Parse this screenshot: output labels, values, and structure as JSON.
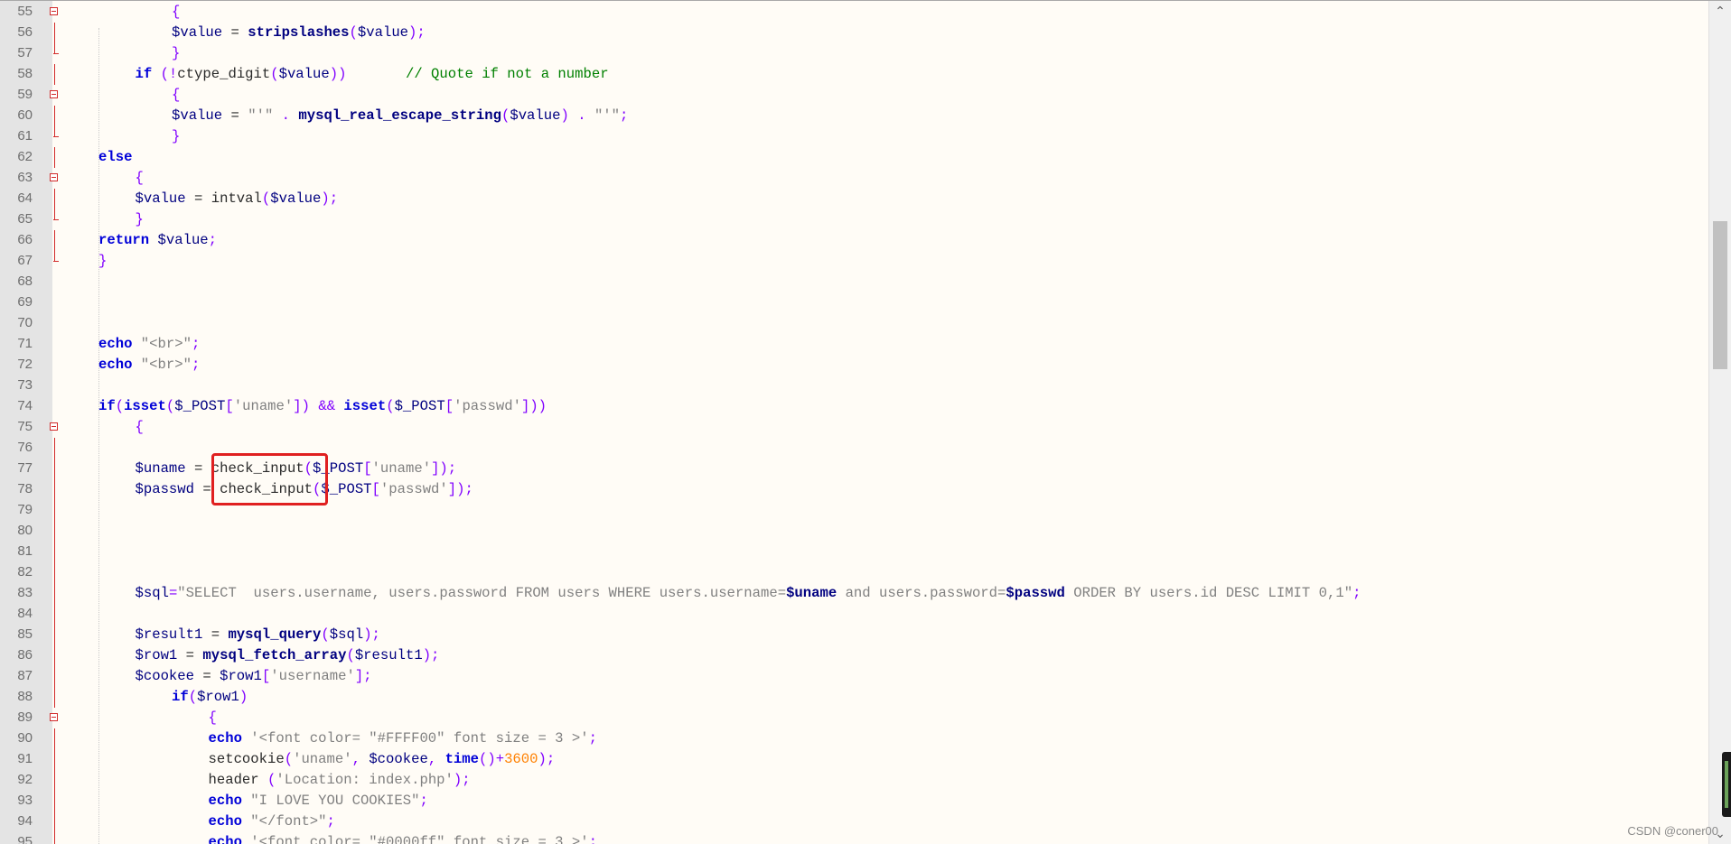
{
  "lines": [
    {
      "n": "55",
      "indent": 3,
      "fold": "open",
      "tokens": [
        {
          "t": "{",
          "c": "punc"
        }
      ]
    },
    {
      "n": "56",
      "indent": 3,
      "fold": "line",
      "tokens": [
        {
          "t": "$value",
          "c": "var"
        },
        {
          "t": " = ",
          "c": ""
        },
        {
          "t": "stripslashes",
          "c": "fn"
        },
        {
          "t": "(",
          "c": "punc"
        },
        {
          "t": "$value",
          "c": "var"
        },
        {
          "t": ");",
          "c": "punc"
        }
      ]
    },
    {
      "n": "57",
      "indent": 3,
      "fold": "end",
      "tokens": [
        {
          "t": "}",
          "c": "punc"
        }
      ]
    },
    {
      "n": "58",
      "indent": 2,
      "fold": "line",
      "tokens": [
        {
          "t": "if",
          "c": "kw"
        },
        {
          "t": " (!",
          "c": "punc"
        },
        {
          "t": "ctype_digit",
          "c": ""
        },
        {
          "t": "(",
          "c": "punc"
        },
        {
          "t": "$value",
          "c": "var"
        },
        {
          "t": "))",
          "c": "punc"
        },
        {
          "t": "       // Quote if not a number",
          "c": "cmt"
        }
      ]
    },
    {
      "n": "59",
      "indent": 3,
      "fold": "open",
      "tokens": [
        {
          "t": "{",
          "c": "punc"
        }
      ]
    },
    {
      "n": "60",
      "indent": 3,
      "fold": "line",
      "tokens": [
        {
          "t": "$value",
          "c": "var"
        },
        {
          "t": " = ",
          "c": ""
        },
        {
          "t": "\"'\"",
          "c": "str"
        },
        {
          "t": " . ",
          "c": "punc"
        },
        {
          "t": "mysql_real_escape_string",
          "c": "fn"
        },
        {
          "t": "(",
          "c": "punc"
        },
        {
          "t": "$value",
          "c": "var"
        },
        {
          "t": ")",
          "c": "punc"
        },
        {
          "t": " . ",
          "c": "punc"
        },
        {
          "t": "\"'\"",
          "c": "str"
        },
        {
          "t": ";",
          "c": "punc"
        }
      ]
    },
    {
      "n": "61",
      "indent": 3,
      "fold": "end",
      "tokens": [
        {
          "t": "}",
          "c": "punc"
        }
      ]
    },
    {
      "n": "62",
      "indent": 1,
      "fold": "line",
      "tokens": [
        {
          "t": "else",
          "c": "kw"
        }
      ]
    },
    {
      "n": "63",
      "indent": 2,
      "fold": "open",
      "tokens": [
        {
          "t": "{",
          "c": "punc"
        }
      ]
    },
    {
      "n": "64",
      "indent": 2,
      "fold": "line",
      "tokens": [
        {
          "t": "$value",
          "c": "var"
        },
        {
          "t": " = ",
          "c": ""
        },
        {
          "t": "intval",
          "c": ""
        },
        {
          "t": "(",
          "c": "punc"
        },
        {
          "t": "$value",
          "c": "var"
        },
        {
          "t": ");",
          "c": "punc"
        }
      ]
    },
    {
      "n": "65",
      "indent": 2,
      "fold": "end",
      "tokens": [
        {
          "t": "}",
          "c": "punc"
        }
      ]
    },
    {
      "n": "66",
      "indent": 1,
      "fold": "line",
      "tokens": [
        {
          "t": "return",
          "c": "kw"
        },
        {
          "t": " ",
          "c": ""
        },
        {
          "t": "$value",
          "c": "var"
        },
        {
          "t": ";",
          "c": "punc"
        }
      ]
    },
    {
      "n": "67",
      "indent": 1,
      "fold": "end",
      "tokens": [
        {
          "t": "}",
          "c": "punc"
        }
      ]
    },
    {
      "n": "68",
      "indent": 0,
      "fold": "",
      "tokens": []
    },
    {
      "n": "69",
      "indent": 0,
      "fold": "",
      "tokens": []
    },
    {
      "n": "70",
      "indent": 0,
      "fold": "",
      "tokens": []
    },
    {
      "n": "71",
      "indent": 1,
      "fold": "",
      "tokens": [
        {
          "t": "echo",
          "c": "kw"
        },
        {
          "t": " ",
          "c": ""
        },
        {
          "t": "\"<br>\"",
          "c": "str"
        },
        {
          "t": ";",
          "c": "punc"
        }
      ]
    },
    {
      "n": "72",
      "indent": 1,
      "fold": "",
      "tokens": [
        {
          "t": "echo",
          "c": "kw"
        },
        {
          "t": " ",
          "c": ""
        },
        {
          "t": "\"<br>\"",
          "c": "str"
        },
        {
          "t": ";",
          "c": "punc"
        }
      ]
    },
    {
      "n": "73",
      "indent": 0,
      "fold": "",
      "tokens": []
    },
    {
      "n": "74",
      "indent": 1,
      "fold": "",
      "tokens": [
        {
          "t": "if",
          "c": "kw"
        },
        {
          "t": "(",
          "c": "punc"
        },
        {
          "t": "isset",
          "c": "kw"
        },
        {
          "t": "(",
          "c": "punc"
        },
        {
          "t": "$_POST",
          "c": "var"
        },
        {
          "t": "[",
          "c": "punc"
        },
        {
          "t": "'uname'",
          "c": "str"
        },
        {
          "t": "])",
          "c": "punc"
        },
        {
          "t": " && ",
          "c": "punc"
        },
        {
          "t": "isset",
          "c": "kw"
        },
        {
          "t": "(",
          "c": "punc"
        },
        {
          "t": "$_POST",
          "c": "var"
        },
        {
          "t": "[",
          "c": "punc"
        },
        {
          "t": "'passwd'",
          "c": "str"
        },
        {
          "t": "]))",
          "c": "punc"
        }
      ]
    },
    {
      "n": "75",
      "indent": 2,
      "fold": "open",
      "tokens": [
        {
          "t": "{",
          "c": "punc"
        }
      ]
    },
    {
      "n": "76",
      "indent": 2,
      "fold": "line",
      "tokens": []
    },
    {
      "n": "77",
      "indent": 2,
      "fold": "line",
      "tokens": [
        {
          "t": "$uname",
          "c": "var"
        },
        {
          "t": " = ",
          "c": ""
        },
        {
          "t": "check_input",
          "c": ""
        },
        {
          "t": "(",
          "c": "punc"
        },
        {
          "t": "$_POST",
          "c": "var"
        },
        {
          "t": "[",
          "c": "punc"
        },
        {
          "t": "'uname'",
          "c": "str"
        },
        {
          "t": "]);",
          "c": "punc"
        }
      ]
    },
    {
      "n": "78",
      "indent": 2,
      "fold": "line",
      "tokens": [
        {
          "t": "$passwd",
          "c": "var"
        },
        {
          "t": " = ",
          "c": ""
        },
        {
          "t": "check_input",
          "c": ""
        },
        {
          "t": "(",
          "c": "punc"
        },
        {
          "t": "$_POST",
          "c": "var"
        },
        {
          "t": "[",
          "c": "punc"
        },
        {
          "t": "'passwd'",
          "c": "str"
        },
        {
          "t": "]);",
          "c": "punc"
        }
      ]
    },
    {
      "n": "79",
      "indent": 2,
      "fold": "line",
      "tokens": []
    },
    {
      "n": "80",
      "indent": 2,
      "fold": "line",
      "tokens": []
    },
    {
      "n": "81",
      "indent": 2,
      "fold": "line",
      "tokens": []
    },
    {
      "n": "82",
      "indent": 2,
      "fold": "line",
      "tokens": []
    },
    {
      "n": "83",
      "indent": 2,
      "fold": "line",
      "tokens": [
        {
          "t": "$sql",
          "c": "var"
        },
        {
          "t": "=",
          "c": "punc"
        },
        {
          "t": "\"SELECT  users.username, users.password FROM users WHERE users.username=",
          "c": "str"
        },
        {
          "t": "$uname",
          "c": "fn"
        },
        {
          "t": " and users.password=",
          "c": "str"
        },
        {
          "t": "$passwd",
          "c": "fn"
        },
        {
          "t": " ORDER BY users.id DESC LIMIT 0,1\"",
          "c": "str"
        },
        {
          "t": ";",
          "c": "punc"
        }
      ]
    },
    {
      "n": "84",
      "indent": 2,
      "fold": "line",
      "tokens": []
    },
    {
      "n": "85",
      "indent": 2,
      "fold": "line",
      "tokens": [
        {
          "t": "$result1",
          "c": "var"
        },
        {
          "t": " = ",
          "c": ""
        },
        {
          "t": "mysql_query",
          "c": "fn"
        },
        {
          "t": "(",
          "c": "punc"
        },
        {
          "t": "$sql",
          "c": "var"
        },
        {
          "t": ");",
          "c": "punc"
        }
      ]
    },
    {
      "n": "86",
      "indent": 2,
      "fold": "line",
      "tokens": [
        {
          "t": "$row1",
          "c": "var"
        },
        {
          "t": " = ",
          "c": ""
        },
        {
          "t": "mysql_fetch_array",
          "c": "fn"
        },
        {
          "t": "(",
          "c": "punc"
        },
        {
          "t": "$result1",
          "c": "var"
        },
        {
          "t": ");",
          "c": "punc"
        }
      ]
    },
    {
      "n": "87",
      "indent": 2,
      "fold": "line",
      "tokens": [
        {
          "t": "$cookee",
          "c": "var"
        },
        {
          "t": " = ",
          "c": ""
        },
        {
          "t": "$row1",
          "c": "var"
        },
        {
          "t": "[",
          "c": "punc"
        },
        {
          "t": "'username'",
          "c": "str"
        },
        {
          "t": "];",
          "c": "punc"
        }
      ]
    },
    {
      "n": "88",
      "indent": 3,
      "fold": "line",
      "tokens": [
        {
          "t": "if",
          "c": "kw"
        },
        {
          "t": "(",
          "c": "punc"
        },
        {
          "t": "$row1",
          "c": "var"
        },
        {
          "t": ")",
          "c": "punc"
        }
      ]
    },
    {
      "n": "89",
      "indent": 4,
      "fold": "open",
      "tokens": [
        {
          "t": "{",
          "c": "punc"
        }
      ]
    },
    {
      "n": "90",
      "indent": 4,
      "fold": "line",
      "tokens": [
        {
          "t": "echo",
          "c": "kw"
        },
        {
          "t": " ",
          "c": ""
        },
        {
          "t": "'<font color= \"#FFFF00\" font size = 3 >'",
          "c": "str"
        },
        {
          "t": ";",
          "c": "punc"
        }
      ]
    },
    {
      "n": "91",
      "indent": 4,
      "fold": "line",
      "tokens": [
        {
          "t": "setcookie",
          "c": ""
        },
        {
          "t": "(",
          "c": "punc"
        },
        {
          "t": "'uname'",
          "c": "str"
        },
        {
          "t": ", ",
          "c": "punc"
        },
        {
          "t": "$cookee",
          "c": "var"
        },
        {
          "t": ", ",
          "c": "punc"
        },
        {
          "t": "time",
          "c": "kw"
        },
        {
          "t": "()+",
          "c": "punc"
        },
        {
          "t": "3600",
          "c": "num"
        },
        {
          "t": ");",
          "c": "punc"
        }
      ]
    },
    {
      "n": "92",
      "indent": 4,
      "fold": "line",
      "tokens": [
        {
          "t": "header",
          "c": ""
        },
        {
          "t": " (",
          "c": "punc"
        },
        {
          "t": "'Location: index.php'",
          "c": "str"
        },
        {
          "t": ");",
          "c": "punc"
        }
      ]
    },
    {
      "n": "93",
      "indent": 4,
      "fold": "line",
      "tokens": [
        {
          "t": "echo",
          "c": "kw"
        },
        {
          "t": " ",
          "c": ""
        },
        {
          "t": "\"I LOVE YOU COOKIES\"",
          "c": "str"
        },
        {
          "t": ";",
          "c": "punc"
        }
      ]
    },
    {
      "n": "94",
      "indent": 4,
      "fold": "line",
      "tokens": [
        {
          "t": "echo",
          "c": "kw"
        },
        {
          "t": " ",
          "c": ""
        },
        {
          "t": "\"</font>\"",
          "c": "str"
        },
        {
          "t": ";",
          "c": "punc"
        }
      ]
    },
    {
      "n": "95",
      "indent": 4,
      "fold": "line",
      "tokens": [
        {
          "t": "echo",
          "c": "kw"
        },
        {
          "t": " ",
          "c": ""
        },
        {
          "t": "'<font color= \"#0000ff\" font size = 3 >'",
          "c": "str"
        },
        {
          "t": ";",
          "c": "punc"
        }
      ]
    }
  ],
  "scrollbar": {
    "up_glyph": "⌃",
    "down_glyph": "⌄"
  },
  "watermark": "CSDN @coner00",
  "colors": {
    "keyword": "#0000d8",
    "string": "#808080",
    "comment": "#008000",
    "number": "#ff8000",
    "highlight": "#e02020",
    "fold": "#d12a2a"
  }
}
